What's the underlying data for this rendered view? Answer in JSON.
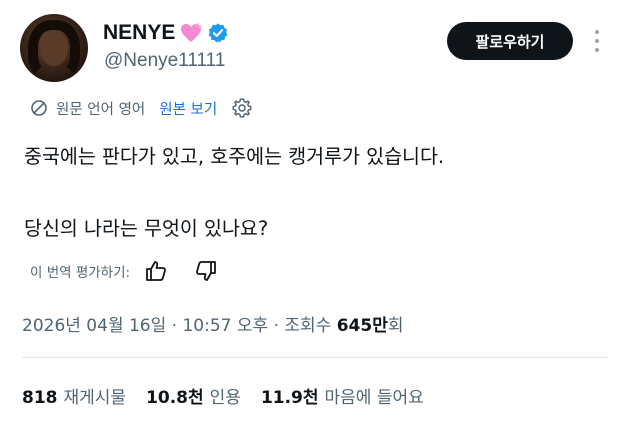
{
  "user": {
    "display_name": "NENYE",
    "handle": "@Nenye11111",
    "heart_color": "#f28ad6",
    "verified_color": "#1d9bf0"
  },
  "header": {
    "follow_label": "팔로우하기"
  },
  "translation": {
    "label": "원문 언어 영어",
    "show_original": "원본 보기"
  },
  "tweet": {
    "lines": [
      "중국에는 판다가 있고, 호주에는 캥거루가 있습니다.",
      "당신의 나라는 무엇이 있나요?"
    ]
  },
  "rating": {
    "label": "이 번역 평가하기:"
  },
  "meta": {
    "date": "2026년 04월 16일",
    "separator": " · ",
    "time": "10:57 오후",
    "views_label": "조회수",
    "views_value": "645만",
    "views_suffix": "회"
  },
  "stats": {
    "reposts_value": "818",
    "reposts_label": "재게시물",
    "quotes_value": "10.8천",
    "quotes_label": "인용",
    "likes_value": "11.9천",
    "likes_label": "마음에 들어요"
  },
  "icons": [
    "heart-emoji-icon",
    "verified-badge-icon",
    "more-options-icon",
    "translate-icon",
    "gear-icon",
    "thumb-up-icon",
    "thumb-down-icon"
  ]
}
